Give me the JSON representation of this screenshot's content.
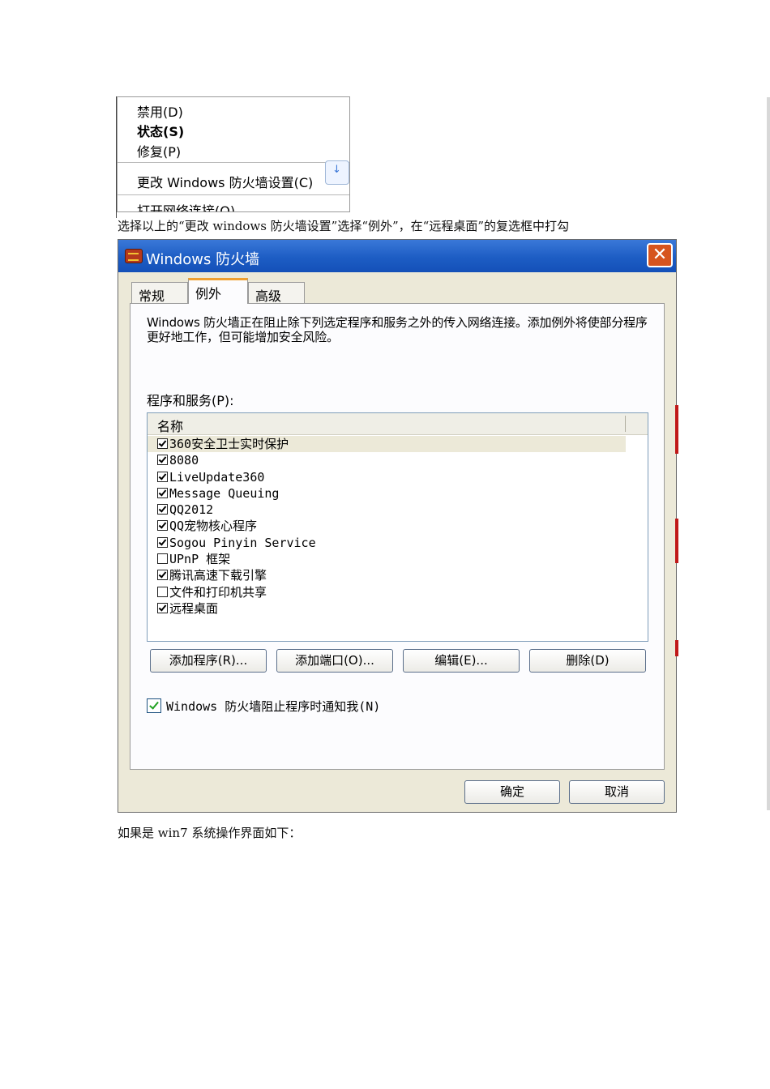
{
  "context_menu": {
    "items": [
      "禁用(D)",
      "状态(S)",
      "修复(P)",
      "更改 Windows 防火墙设置(C)"
    ],
    "partial_item": "打开网络连接(O)",
    "balloon_icon": "arrow-down-icon"
  },
  "instruction_text": "选择以上的“更改 windows 防火墙设置”选择“例外”，在“远程桌面”的复选框中打勾",
  "dialog": {
    "title": "Windows 防火墙",
    "close_glyph": "✕",
    "tabs": [
      "常规",
      "例外",
      "高级"
    ],
    "active_tab": "例外",
    "description": "Windows 防火墙正在阻止除下列选定程序和服务之外的传入网络连接。添加例外将使部分程序更好地工作，但可能增加安全风险。",
    "list_label": "程序和服务(P):",
    "column_header": "名称",
    "programs": [
      {
        "name": "360安全卫士实时保护",
        "checked": true
      },
      {
        "name": "8080",
        "checked": true
      },
      {
        "name": "LiveUpdate360",
        "checked": true
      },
      {
        "name": "Message Queuing",
        "checked": true
      },
      {
        "name": "QQ2012",
        "checked": true
      },
      {
        "name": "QQ宠物核心程序",
        "checked": true
      },
      {
        "name": "Sogou Pinyin Service",
        "checked": true
      },
      {
        "name": "UPnP 框架",
        "checked": false
      },
      {
        "name": "腾讯高速下载引擎",
        "checked": true
      },
      {
        "name": "文件和打印机共享",
        "checked": false
      },
      {
        "name": "远程桌面",
        "checked": true
      }
    ],
    "buttons": {
      "add_program": "添加程序(R)...",
      "add_port": "添加端口(O)...",
      "edit": "编辑(E)...",
      "delete": "删除(D)"
    },
    "notify_label": "Windows 防火墙阻止程序时通知我(N)",
    "notify_checked": true,
    "ok": "确定",
    "cancel": "取消"
  },
  "footer_text": "如果是 win7 系统操作界面如下：",
  "colors": {
    "titlebar": "#1d5dc4",
    "dialog_bg": "#ece9d8",
    "close_button": "#d6541e",
    "active_tab_accent": "#f0a030"
  }
}
